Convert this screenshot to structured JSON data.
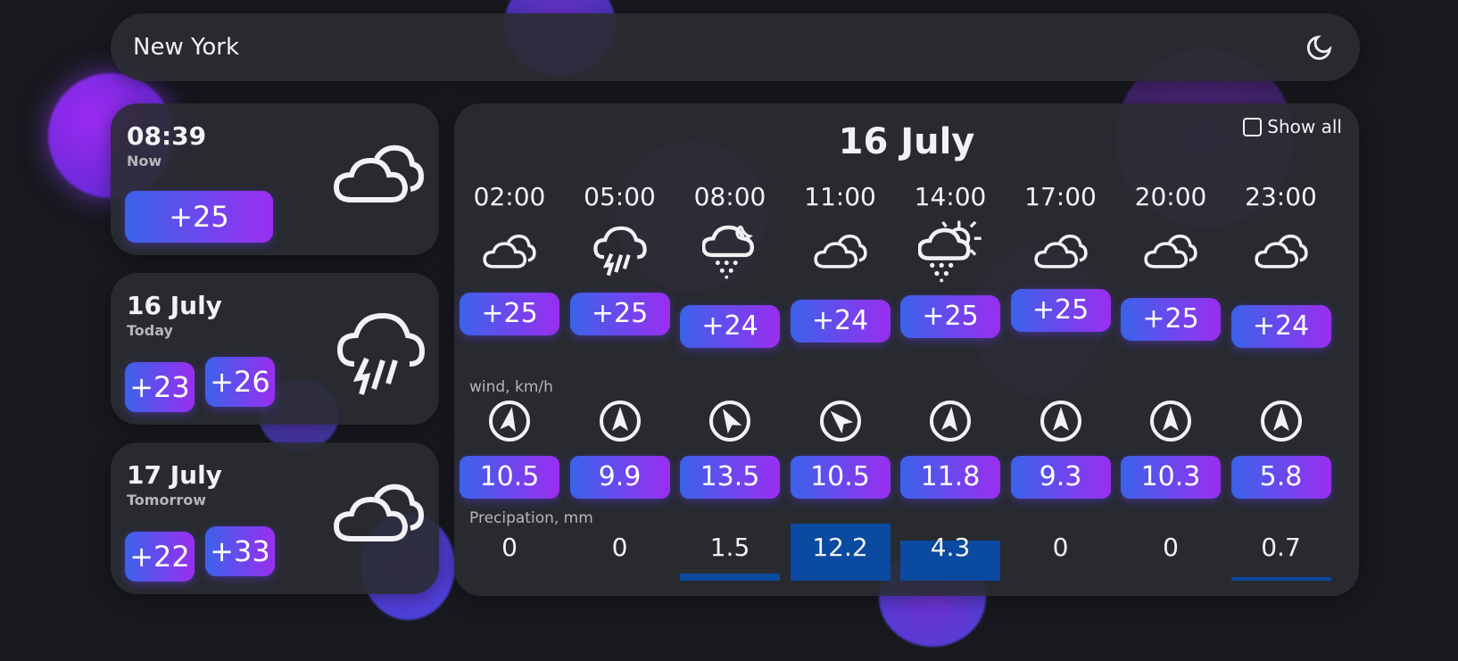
{
  "search": {
    "value": "New York"
  },
  "now_card": {
    "time": "08:39",
    "label": "Now",
    "temp": "+25",
    "icon": "clouds-icon"
  },
  "today_card": {
    "date": "16 July",
    "label": "Today",
    "temp_min": "+23",
    "temp_max": "+26",
    "icon": "thunderstorm-rain-icon"
  },
  "tomorrow_card": {
    "date": "17 July",
    "label": "Tomorrow",
    "temp_min": "+22",
    "temp_max": "+33",
    "icon": "clouds-icon"
  },
  "main": {
    "title": "16 July",
    "show_all_label": "Show all",
    "show_all_checked": false,
    "wind_label": "wind, km/h",
    "precip_label": "Precipation, mm",
    "hours": [
      {
        "time": "02:00",
        "icon": "clouds-icon",
        "temp": "+25",
        "wind": "10.5",
        "wind_dir": 10,
        "precip": "0",
        "precip_level": 0
      },
      {
        "time": "05:00",
        "icon": "thunderstorm-rain-icon",
        "temp": "+25",
        "wind": "9.9",
        "wind_dir": 0,
        "precip": "0",
        "precip_level": 0
      },
      {
        "time": "08:00",
        "icon": "rain-night-icon",
        "temp": "+24",
        "wind": "13.5",
        "wind_dir": -30,
        "precip": "1.5",
        "precip_level": 0.12
      },
      {
        "time": "11:00",
        "icon": "clouds-icon",
        "temp": "+24",
        "wind": "10.5",
        "wind_dir": -45,
        "precip": "12.2",
        "precip_level": 1.0
      },
      {
        "time": "14:00",
        "icon": "rain-sun-icon",
        "temp": "+25",
        "wind": "11.8",
        "wind_dir": 5,
        "precip": "4.3",
        "precip_level": 0.7
      },
      {
        "time": "17:00",
        "icon": "clouds-icon",
        "temp": "+25",
        "wind": "9.3",
        "wind_dir": 0,
        "precip": "0",
        "precip_level": 0
      },
      {
        "time": "20:00",
        "icon": "clouds-icon",
        "temp": "+25",
        "wind": "10.3",
        "wind_dir": 0,
        "precip": "0",
        "precip_level": 0
      },
      {
        "time": "23:00",
        "icon": "clouds-icon",
        "temp": "+24",
        "wind": "5.8",
        "wind_dir": 0,
        "precip": "0.7",
        "precip_level": 0.06
      }
    ]
  },
  "colors": {
    "background": "#17191e",
    "panel": "#2a2c32",
    "pill_start": "#3a63ea",
    "pill_end": "#9a2ef0",
    "precip_fill": "#0a4aa0"
  }
}
